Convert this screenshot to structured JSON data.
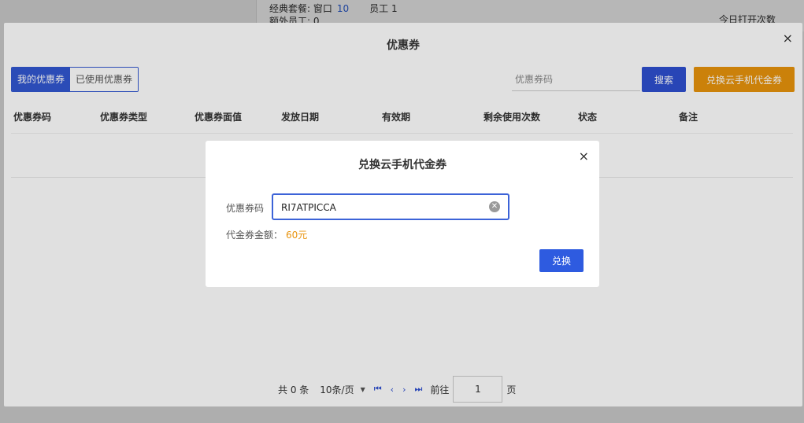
{
  "background": {
    "package_label": "经典套餐: 窗口",
    "window_count": "10",
    "staff_label": "员工 1",
    "extra_staff": "额外员工: 0",
    "today_opens": "今日打开次数"
  },
  "coupon_modal": {
    "title": "优惠券",
    "close": "×",
    "tabs": [
      {
        "label": "我的优惠券",
        "active": true
      },
      {
        "label": "已使用优惠券",
        "active": false
      }
    ],
    "search": {
      "placeholder": "优惠券码",
      "button": "搜索"
    },
    "redeem_button": "兑换云手机代金券",
    "table": {
      "columns": [
        "优惠券码",
        "优惠券类型",
        "优惠券面值",
        "发放日期",
        "有效期",
        "剩余使用次数",
        "状态",
        "备注"
      ],
      "rows": []
    },
    "pagination": {
      "total": "共 0 条",
      "page_size": "10条/页",
      "first": "⏮",
      "prev": "‹",
      "next": "›",
      "last": "⏭",
      "goto_label": "前往",
      "page": "1",
      "page_unit": "页"
    }
  },
  "redeem_dialog": {
    "title": "兑换云手机代金券",
    "close": "×",
    "code_label": "优惠券码",
    "code_value": "RI7ATPICCA",
    "amount_label": "代金券金额：",
    "amount_value": "60元",
    "confirm_button": "兑换"
  },
  "colors": {
    "primary": "#2e4fd0",
    "accent_orange": "#e8930c"
  }
}
